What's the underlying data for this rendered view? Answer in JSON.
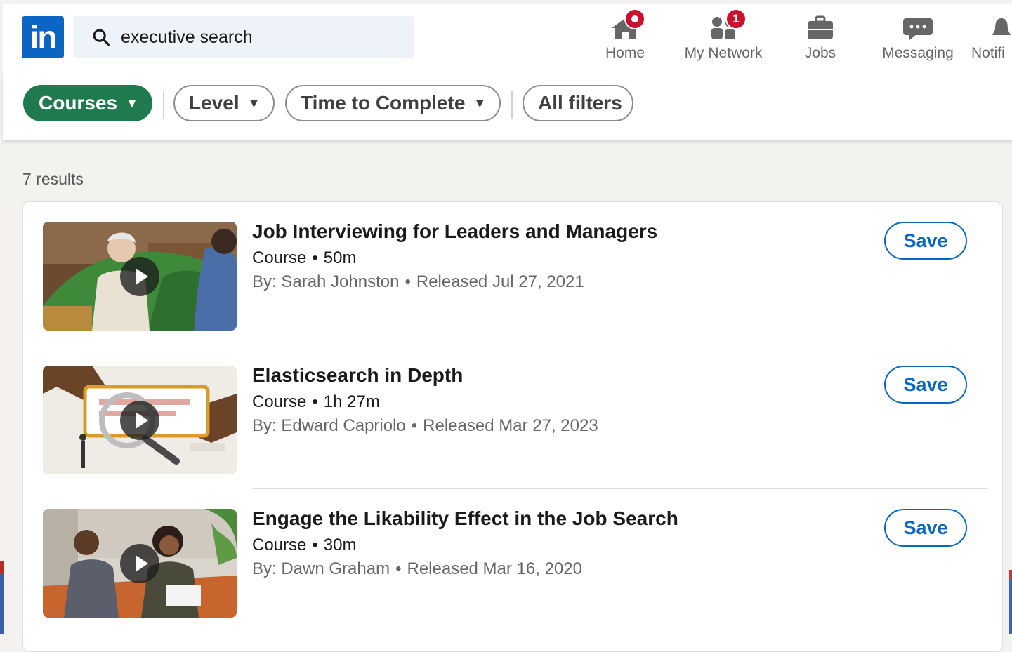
{
  "nav": {
    "search_value": "executive search",
    "items": [
      {
        "label": "Home",
        "icon": "home-icon",
        "badge": ""
      },
      {
        "label": "My Network",
        "icon": "people-icon",
        "badge": "1"
      },
      {
        "label": "Jobs",
        "icon": "briefcase-icon",
        "badge": ""
      },
      {
        "label": "Messaging",
        "icon": "chat-bubble-icon",
        "badge": ""
      },
      {
        "label": "Notifi",
        "icon": "bell-icon",
        "badge": ""
      }
    ],
    "logo_text": "in"
  },
  "filters": {
    "courses": "Courses",
    "level": "Level",
    "time": "Time to Complete",
    "all": "All filters"
  },
  "results": {
    "count": "7 results",
    "items": [
      {
        "title": "Job Interviewing for Leaders and Managers",
        "type": "Course",
        "duration": "50m",
        "author": "By: Sarah Johnston",
        "released": "Released Jul 27, 2021",
        "save": "Save"
      },
      {
        "title": "Elasticsearch in Depth",
        "type": "Course",
        "duration": "1h 27m",
        "author": "By: Edward Capriolo",
        "released": "Released Mar 27, 2023",
        "save": "Save"
      },
      {
        "title": "Engage the Likability Effect in the Job Search",
        "type": "Course",
        "duration": "30m",
        "author": "By: Dawn Graham",
        "released": "Released Mar 16, 2020",
        "save": "Save"
      }
    ]
  },
  "colors": {
    "brand": "#0a66c2",
    "filter_active": "#1f7a4d",
    "badge": "#cb112d"
  }
}
